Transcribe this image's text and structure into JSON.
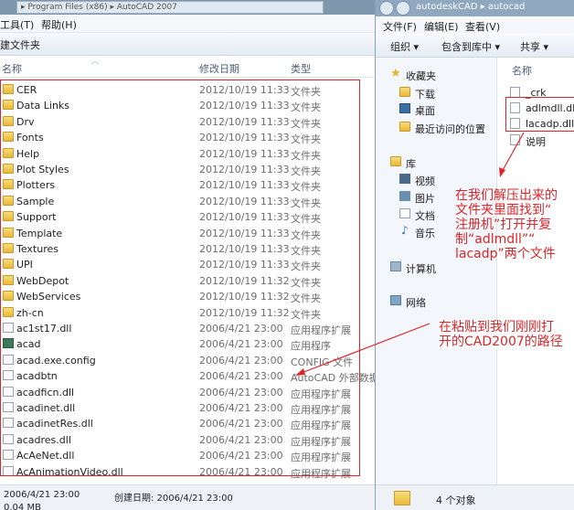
{
  "left": {
    "address": "▸ Program Files (x86) ▸ AutoCAD 2007",
    "menu": [
      "工具(T)",
      "帮助(H)"
    ],
    "new_folder": "建文件夹",
    "columns": {
      "name": "名称",
      "date": "修改日期",
      "type": "类型"
    },
    "files": [
      {
        "name": "CER",
        "date": "2012/10/19 11:33",
        "type": "文件夹",
        "kind": "folder"
      },
      {
        "name": "Data Links",
        "date": "2012/10/19 11:33",
        "type": "文件夹",
        "kind": "folder"
      },
      {
        "name": "Drv",
        "date": "2012/10/19 11:33",
        "type": "文件夹",
        "kind": "folder"
      },
      {
        "name": "Fonts",
        "date": "2012/10/19 11:33",
        "type": "文件夹",
        "kind": "folder"
      },
      {
        "name": "Help",
        "date": "2012/10/19 11:33",
        "type": "文件夹",
        "kind": "folder"
      },
      {
        "name": "Plot Styles",
        "date": "2012/10/19 11:33",
        "type": "文件夹",
        "kind": "folder"
      },
      {
        "name": "Plotters",
        "date": "2012/10/19 11:33",
        "type": "文件夹",
        "kind": "folder"
      },
      {
        "name": "Sample",
        "date": "2012/10/19 11:33",
        "type": "文件夹",
        "kind": "folder"
      },
      {
        "name": "Support",
        "date": "2012/10/19 11:33",
        "type": "文件夹",
        "kind": "folder"
      },
      {
        "name": "Template",
        "date": "2012/10/19 11:33",
        "type": "文件夹",
        "kind": "folder"
      },
      {
        "name": "Textures",
        "date": "2012/10/19 11:33",
        "type": "文件夹",
        "kind": "folder"
      },
      {
        "name": "UPI",
        "date": "2012/10/19 11:33",
        "type": "文件夹",
        "kind": "folder"
      },
      {
        "name": "WebDepot",
        "date": "2012/10/19 11:32",
        "type": "文件夹",
        "kind": "folder"
      },
      {
        "name": "WebServices",
        "date": "2012/10/19 11:32",
        "type": "文件夹",
        "kind": "folder"
      },
      {
        "name": "zh-cn",
        "date": "2012/10/19 11:32",
        "type": "文件夹",
        "kind": "folder"
      },
      {
        "name": "ac1st17.dll",
        "date": "2006/4/21 23:00",
        "type": "应用程序扩展",
        "kind": "file"
      },
      {
        "name": "acad",
        "date": "2006/4/21 23:00",
        "type": "应用程序",
        "kind": "app"
      },
      {
        "name": "acad.exe.config",
        "date": "2006/4/21 23:00",
        "type": "CONFIG 文件",
        "kind": "file"
      },
      {
        "name": "acadbtn",
        "date": "2006/4/21 23:00",
        "type": "AutoCAD 外部数据",
        "kind": "file"
      },
      {
        "name": "acadficn.dll",
        "date": "2006/4/21 23:00",
        "type": "应用程序扩展",
        "kind": "file"
      },
      {
        "name": "acadinet.dll",
        "date": "2006/4/21 23:00",
        "type": "应用程序扩展",
        "kind": "file"
      },
      {
        "name": "acadinetRes.dll",
        "date": "2006/4/21 23:00",
        "type": "应用程序扩展",
        "kind": "file"
      },
      {
        "name": "acadres.dll",
        "date": "2006/4/21 23:00",
        "type": "应用程序扩展",
        "kind": "file"
      },
      {
        "name": "AcAeNet.dll",
        "date": "2006/4/21 23:00",
        "type": "应用程序扩展",
        "kind": "file"
      },
      {
        "name": "AcAnimationVideo.dll",
        "date": "2006/4/21 23:00",
        "type": "应用程序扩展",
        "kind": "file"
      }
    ],
    "status_modified": "2006/4/21 23:00",
    "status_created": "创建日期: 2006/4/21 23:00",
    "status_size": "0.04 MB"
  },
  "right": {
    "address": "autodeskCAD ▸ autocad",
    "menu": [
      "文件(F)",
      "编辑(E)",
      "查看(V)"
    ],
    "toolbar": {
      "organize": "组织 ▾",
      "include": "包含到库中 ▾",
      "share": "共享 ▾"
    },
    "nav": {
      "favorites": "收藏夹",
      "downloads": "下载",
      "desktop": "桌面",
      "recent": "最近访问的位置",
      "libraries": "库",
      "video": "视频",
      "pictures": "图片",
      "documents": "文档",
      "music": "音乐",
      "computer": "计算机",
      "network": "网络"
    },
    "column_name": "名称",
    "files": [
      "_crk",
      "adlmdll.dll",
      "lacadp.dll",
      "说明"
    ],
    "status": "4 个对象"
  },
  "annotations": {
    "a1": [
      "在我们解压出来的",
      "文件夹里面找到“",
      "注册机”打开并复",
      "制“adlmdll”“",
      "lacadp”两个文件"
    ],
    "a2": [
      "在粘贴到我们刚刚打",
      "开的CAD2007的路径"
    ]
  },
  "colors": {
    "annotation": "#d9262b",
    "accent": "#3b6ea5"
  }
}
